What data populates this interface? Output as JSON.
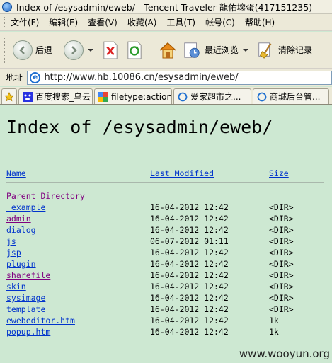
{
  "window": {
    "title": "Index of /esysadmin/eweb/ - Tencent Traveler  龍佑壞蛋(417151235)"
  },
  "menu": [
    {
      "label": "文件(F)"
    },
    {
      "label": "编辑(E)"
    },
    {
      "label": "查看(V)"
    },
    {
      "label": "收藏(A)"
    },
    {
      "label": "工具(T)"
    },
    {
      "label": "帐号(C)"
    },
    {
      "label": "帮助(H)"
    }
  ],
  "toolbar": {
    "back_label": "后退",
    "recent_label": "最近浏览",
    "clear_label": "清除记录"
  },
  "address": {
    "label": "地址",
    "url": "http://www.hb.10086.cn/esysadmin/eweb/"
  },
  "tabs": [
    {
      "label": "百度搜索_乌云"
    },
    {
      "label": "filetype:action..."
    },
    {
      "label": "爱家超市之..."
    },
    {
      "label": "商城后台管..."
    }
  ],
  "page": {
    "heading": "Index of /esysadmin/eweb/",
    "columns": {
      "name": "Name",
      "modified": "Last Modified",
      "size": "Size"
    },
    "parent": "Parent Directory",
    "rows": [
      {
        "name": "_example",
        "date": "16-04-2012 12:42",
        "size": "<DIR>",
        "visited": false
      },
      {
        "name": "admin",
        "date": "16-04-2012 12:42",
        "size": "<DIR>",
        "visited": true
      },
      {
        "name": "dialog",
        "date": "16-04-2012 12:42",
        "size": "<DIR>",
        "visited": false
      },
      {
        "name": "js",
        "date": "06-07-2012 01:11",
        "size": "<DIR>",
        "visited": false
      },
      {
        "name": "jsp",
        "date": "16-04-2012 12:42",
        "size": "<DIR>",
        "visited": false
      },
      {
        "name": "plugin",
        "date": "16-04-2012 12:42",
        "size": "<DIR>",
        "visited": false
      },
      {
        "name": "sharefile",
        "date": "16-04-2012 12:42",
        "size": "<DIR>",
        "visited": true
      },
      {
        "name": "skin",
        "date": "16-04-2012 12:42",
        "size": "<DIR>",
        "visited": false
      },
      {
        "name": "sysimage",
        "date": "16-04-2012 12:42",
        "size": "<DIR>",
        "visited": false
      },
      {
        "name": "template",
        "date": "16-04-2012 12:42",
        "size": "<DIR>",
        "visited": false
      },
      {
        "name": "ewebeditor.htm",
        "date": "16-04-2012 12:42",
        "size": "1k",
        "visited": false
      },
      {
        "name": "popup.htm",
        "date": "16-04-2012 12:42",
        "size": "1k",
        "visited": false
      }
    ],
    "watermark": "www.wooyun.org"
  },
  "colors": {
    "page_bg": "#cde8d2",
    "link": "#0033cc",
    "visited": "#800080"
  }
}
